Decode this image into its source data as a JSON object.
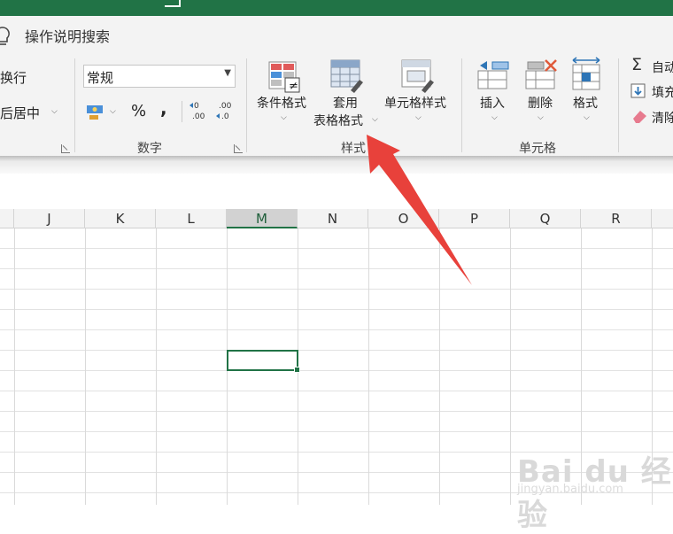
{
  "tell_me": "操作说明搜索",
  "alignment": {
    "wrap_text": "换行",
    "merge_center": "后居中"
  },
  "number": {
    "format_value": "常规",
    "group_label": "数字",
    "percent": "%",
    "comma": ",",
    "increase_decimal": "←0\n.00",
    "decrease_decimal": ".00\n→.0"
  },
  "styles": {
    "conditional_formatting": "条件格式",
    "format_as_table_line1": "套用",
    "format_as_table_line2": "表格格式",
    "cell_styles": "单元格样式",
    "group_label": "样式"
  },
  "cells": {
    "insert": "插入",
    "delete": "删除",
    "format": "格式",
    "group_label": "单元格"
  },
  "editing": {
    "autosum": "自动",
    "fill": "填充",
    "clear": "清除"
  },
  "columns": [
    "J",
    "K",
    "L",
    "M",
    "N",
    "O",
    "P",
    "Q",
    "R"
  ],
  "selected_column": "M",
  "watermark": {
    "text": "Bai du 经验",
    "url": "jingyan.baidu.com"
  },
  "colors": {
    "accent": "#217346",
    "arrow": "#e8413b"
  }
}
